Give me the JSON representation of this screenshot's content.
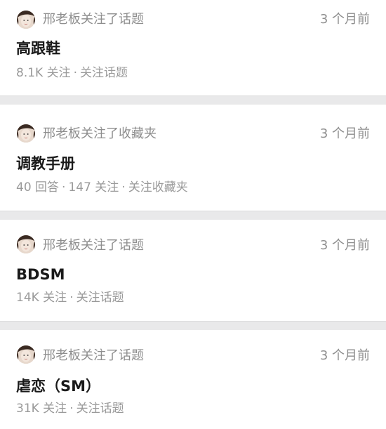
{
  "feed": {
    "items": [
      {
        "action": "邢老板关注了话题",
        "time": "3 个月前",
        "title": "高跟鞋",
        "meta": [
          "8.1K 关注",
          "关注话题"
        ]
      },
      {
        "action": "邢老板关注了收藏夹",
        "time": "3 个月前",
        "title": "调教手册",
        "meta": [
          "40 回答",
          "147 关注",
          "关注收藏夹"
        ]
      },
      {
        "action": "邢老板关注了话题",
        "time": "3 个月前",
        "title": "BDSM",
        "meta": [
          "14K 关注",
          "关注话题"
        ]
      },
      {
        "action": "邢老板关注了话题",
        "time": "3 个月前",
        "title": "虐恋（SM）",
        "meta": [
          "31K 关注",
          "关注话题"
        ]
      }
    ],
    "separator": "·",
    "avatar_icon": "user-avatar"
  }
}
